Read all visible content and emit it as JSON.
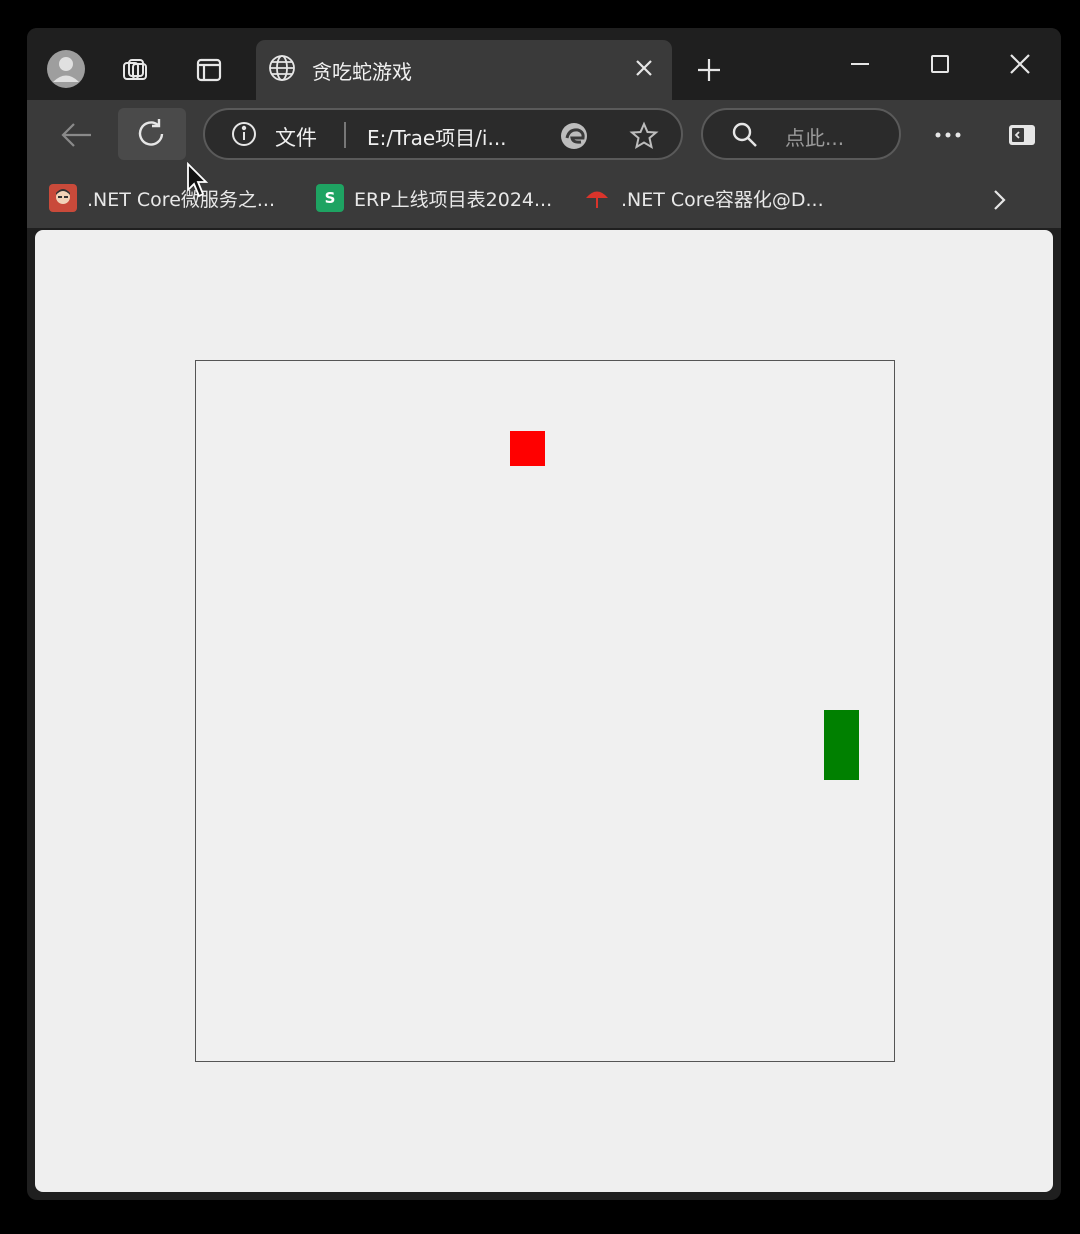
{
  "browser": {
    "tab": {
      "title": "贪吃蛇游戏"
    },
    "address_bar": {
      "file_label": "文件",
      "url": "E:/Trae项目/i..."
    },
    "search": {
      "placeholder": "点此..."
    },
    "bookmarks": [
      {
        "label": ".NET Core微服务之...",
        "icon": "avatar-icon"
      },
      {
        "label": "ERP上线项目表2024...",
        "icon": "spreadsheet-icon",
        "icon_letter": "S"
      },
      {
        "label": ".NET Core容器化@D...",
        "icon": "umbrella-icon"
      }
    ]
  },
  "game": {
    "grid_cells": 20,
    "food": {
      "col": 9,
      "row": 2,
      "color": "#ff0000"
    },
    "snake": {
      "color": "#008000",
      "segments": [
        {
          "col": 18,
          "row": 10
        },
        {
          "col": 18,
          "row": 11
        }
      ]
    },
    "board_color": "#f0f0f0"
  },
  "colors": {
    "frame": "#1f1f1f",
    "toolbar": "#3a3a3a",
    "page_bg": "#efefef"
  }
}
